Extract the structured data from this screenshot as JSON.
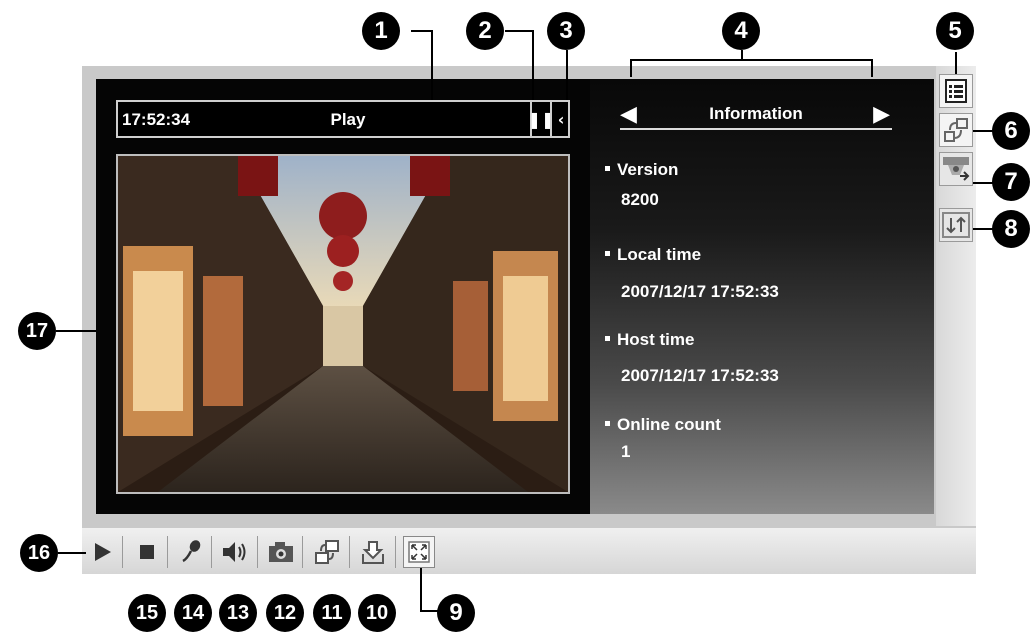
{
  "video_bar": {
    "time": "17:52:34",
    "status": "Play",
    "pause_icon": "pause-icon",
    "collapse_icon": "chevron-left-icon"
  },
  "info_panel": {
    "title": "Information",
    "prev_icon": "triangle-left-icon",
    "next_icon": "triangle-right-icon",
    "items": [
      {
        "label": "Version",
        "value": "8200"
      },
      {
        "label": "Local time",
        "value": "2007/12/17 17:52:33"
      },
      {
        "label": "Host time",
        "value": "2007/12/17 17:52:33"
      },
      {
        "label": "Online count",
        "value": "1"
      }
    ]
  },
  "side_buttons": [
    "list-icon",
    "digital-output-icon",
    "ptz-camera-icon",
    "transfer-icon"
  ],
  "toolbar": [
    "play-icon",
    "stop-icon",
    "microphone-icon",
    "speaker-icon",
    "snapshot-icon",
    "window-switch-icon",
    "download-icon",
    "fullscreen-icon"
  ],
  "callouts": [
    "1",
    "2",
    "3",
    "4",
    "5",
    "6",
    "7",
    "8",
    "9",
    "10",
    "11",
    "12",
    "13",
    "14",
    "15",
    "16",
    "17"
  ],
  "colors": {
    "panel_background": "#000000",
    "frame": "#c9c9c9",
    "toolbar": "#e2e2e2"
  }
}
